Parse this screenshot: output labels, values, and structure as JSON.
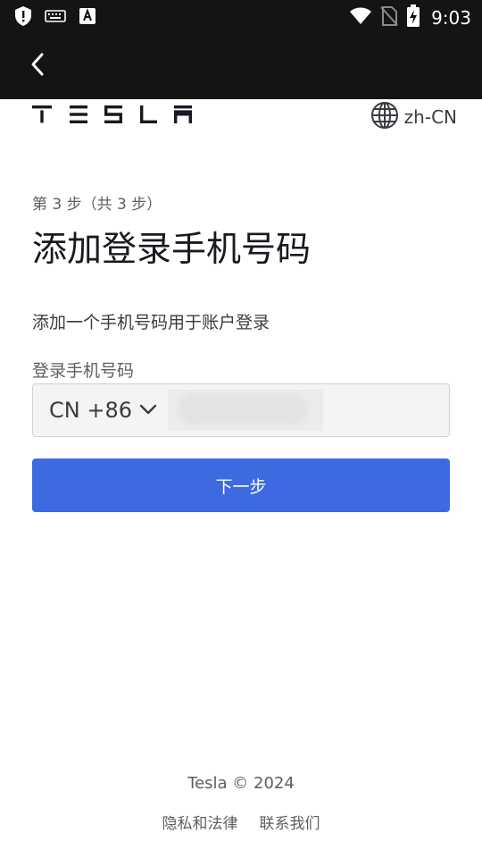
{
  "status_bar": {
    "time": "9:03",
    "icons": [
      "shield-icon",
      "keyboard-icon",
      "font-a-icon",
      "wifi-icon",
      "no-sim-icon",
      "battery-charging-icon"
    ]
  },
  "app_bar": {
    "back_icon": "chevron-left-icon"
  },
  "header": {
    "logo_text": "TESLA",
    "language": "zh-CN",
    "language_icon": "globe-icon"
  },
  "step": {
    "text": "第 3 步（共 3 步）"
  },
  "page": {
    "title": "添加登录手机号码",
    "description": "添加一个手机号码用于账户登录"
  },
  "phone_field": {
    "label": "登录手机号码",
    "country_code": "CN +86",
    "value": "",
    "placeholder": ""
  },
  "actions": {
    "next_label": "下一步"
  },
  "footer": {
    "copyright": "Tesla © 2024",
    "links": [
      "隐私和法律",
      "联系我们"
    ]
  },
  "colors": {
    "accent": "#3e6ae1",
    "bar_background": "#141414",
    "text_primary": "#171a20",
    "text_secondary": "#5c5e62"
  }
}
